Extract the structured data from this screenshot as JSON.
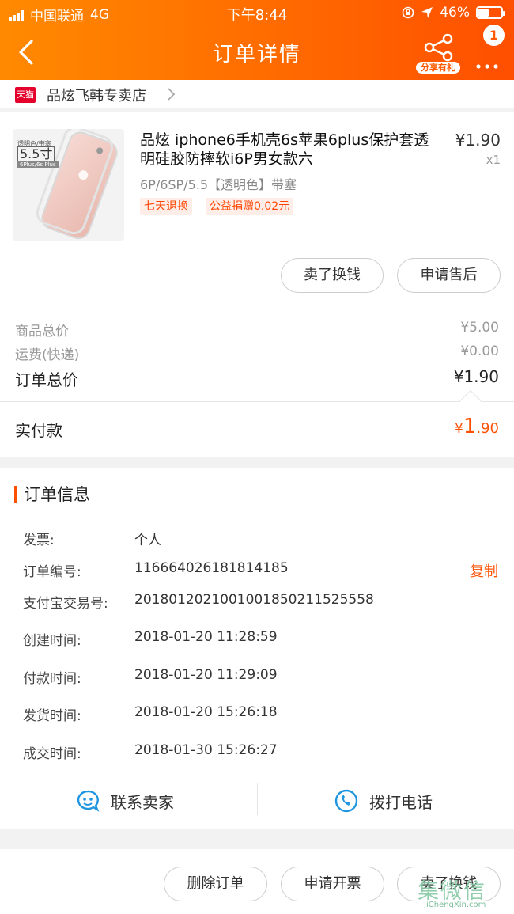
{
  "status_bar": {
    "carrier": "中国联通",
    "network": "4G",
    "time": "下午8:44",
    "battery": "46%",
    "battery_level": 0.46
  },
  "nav": {
    "title": "订单详情",
    "share_label": "分享有礼",
    "badge_count": "1"
  },
  "store": {
    "badge": "天猫",
    "name": "品炫飞韩专卖店"
  },
  "item": {
    "thumb_text_1": "透明色/带塞",
    "thumb_text_2": "5.5寸",
    "thumb_text_3": "6Plus/6s Plus",
    "title": "品炫 iphone6手机壳6s苹果6plus保护套透明硅胶防摔软i6P男女款六",
    "sku": "6P/6SP/5.5【透明色】带塞",
    "tags": [
      "七天退换",
      "公益捐赠0.02元"
    ],
    "price": "¥1.90",
    "quantity": "x1",
    "buttons": [
      "卖了换钱",
      "申请售后"
    ]
  },
  "summary": {
    "goods_total_label": "商品总价",
    "goods_total": "¥5.00",
    "shipping_label": "运费(快递)",
    "shipping": "¥0.00",
    "order_total_label": "订单总价",
    "order_total": "¥1.90",
    "paid_label": "实付款",
    "paid_currency": "¥",
    "paid_int": "1",
    "paid_dec": ".90"
  },
  "order_info": {
    "heading": "订单信息",
    "rows": [
      {
        "label": "发票:",
        "value": "个人"
      },
      {
        "label": "订单编号:",
        "value": "116664026181814185"
      },
      {
        "label": "支付宝交易号:",
        "value": "2018012021001001850211525558"
      },
      {
        "label": "创建时间:",
        "value": "2018-01-20 11:28:59"
      },
      {
        "label": "付款时间:",
        "value": "2018-01-20 11:29:09"
      },
      {
        "label": "发货时间:",
        "value": "2018-01-20 15:26:18"
      },
      {
        "label": "成交时间:",
        "value": "2018-01-30 15:26:27"
      }
    ],
    "copy_label": "复制",
    "contact_seller": "联系卖家",
    "call_phone": "拨打电话"
  },
  "bottom_bar": {
    "buttons": [
      "删除订单",
      "申请开票",
      "卖了换钱"
    ]
  },
  "watermark": {
    "text": "集微信",
    "sub": "JiChengXin.com"
  },
  "colors": {
    "accent": "#ff5000",
    "header_start": "#ff8a00",
    "header_end": "#ff4f00",
    "blue_icon": "#2196e0"
  }
}
